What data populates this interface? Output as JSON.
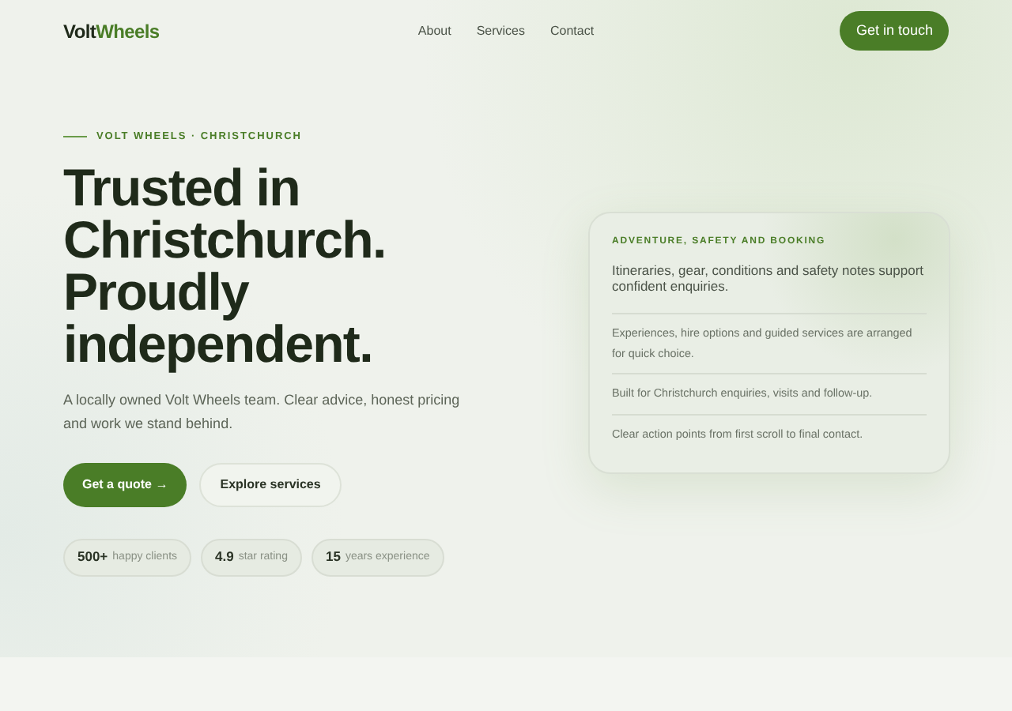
{
  "logo": {
    "first": "Volt",
    "second": "Wheels"
  },
  "nav": [
    "About",
    "Services",
    "Contact"
  ],
  "header_cta": "Get in touch",
  "eyebrow": "VOLT WHEELS · CHRISTCHURCH",
  "headline": [
    "Trusted in",
    "Christchurch.",
    "Proudly",
    "independent."
  ],
  "lead": "A locally owned Volt Wheels team. Clear advice, honest pricing and work we stand behind.",
  "buttons": [
    {
      "label": "Get a quote →",
      "kind": "primary"
    },
    {
      "label": "Explore services",
      "kind": "secondary"
    }
  ],
  "stats": [
    {
      "value": "500+",
      "label": "happy clients"
    },
    {
      "value": "4.9",
      "label": "star rating"
    },
    {
      "value": "15",
      "label": "years experience"
    }
  ],
  "card": {
    "eyebrow": "ADVENTURE, SAFETY AND BOOKING",
    "summary": "Itineraries, gear, conditions and safety notes support confident enquiries.",
    "points": [
      "Experiences, hire options and guided services are arranged for quick choice.",
      "Built for Christchurch enquiries, visits and follow-up.",
      "Clear action points from first scroll to final contact."
    ]
  }
}
